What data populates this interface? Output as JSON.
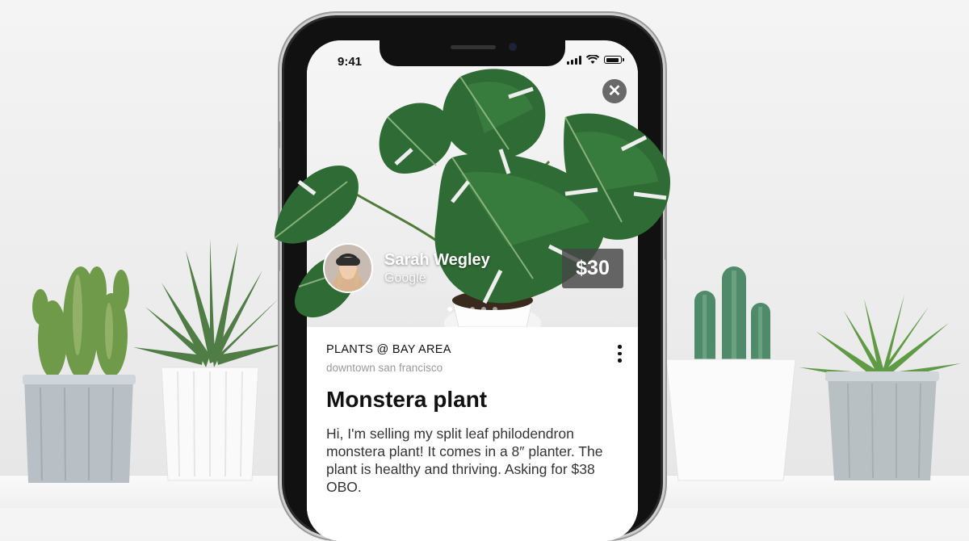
{
  "status_bar": {
    "time": "9:41",
    "icons": [
      "signal-icon",
      "wifi-icon",
      "battery-icon"
    ]
  },
  "listing": {
    "category": "PLANTS @ BAY AREA",
    "location": "downtown san francisco",
    "title": "Monstera plant",
    "description": "Hi, I'm selling my split leaf philodendron monstera plant! It comes in a 8″ planter. The plant is healthy and thriving. Asking for $38 OBO.",
    "price": "$30",
    "image_count": 5,
    "active_image": 1
  },
  "seller": {
    "name": "Sarah Wegley",
    "organization": "Google"
  },
  "colors": {
    "leaf": "#2f6b34",
    "leaf_light": "#3f8a45",
    "price_badge": "#464646",
    "background": "#efefef"
  }
}
